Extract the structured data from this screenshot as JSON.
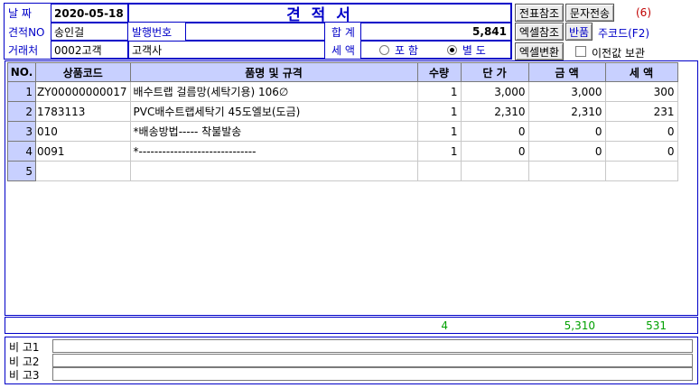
{
  "header": {
    "date_label": "날 짜",
    "date_value": "2020-05-18",
    "title": "견 적 서",
    "quote_no_label": "견적NO",
    "quote_no_value": "송인걸",
    "issue_no_label": "발행번호",
    "issue_no_value": "",
    "total_label": "합 계",
    "total_value": "5,841",
    "client_label": "거래처",
    "client_code": "0002고객",
    "client_name": "고객사",
    "tax_label": "세 액",
    "tax_option_included": "포 함",
    "tax_option_separate": "별 도",
    "tax_selected": "별 도"
  },
  "buttons": {
    "voucher_ref": "전표참조",
    "sms_send": "문자전송",
    "sms_count": "(6)",
    "excel_ref": "엑셀참조",
    "return_item": "반품",
    "main_code": "주코드(F2)",
    "excel_convert": "엑셀변환",
    "keep_previous": "이전값 보관"
  },
  "table": {
    "columns": [
      "NO.",
      "상품코드",
      "품명 및 규격",
      "수량",
      "단 가",
      "금 액",
      "세 액"
    ],
    "rows": [
      {
        "no": "1",
        "code": "ZY00000000017",
        "name": "배수트랩 걸름망(세탁기용) 106∅",
        "qty": "1",
        "price": "3,000",
        "amount": "3,000",
        "tax": "300"
      },
      {
        "no": "2",
        "code": "1783113",
        "name": "PVC배수트랩세탁기 45도엘보(도금)",
        "qty": "1",
        "price": "2,310",
        "amount": "2,310",
        "tax": "231"
      },
      {
        "no": "3",
        "code": "010",
        "name": "*배송방법----- 착불발송",
        "qty": "1",
        "price": "0",
        "amount": "0",
        "tax": "0"
      },
      {
        "no": "4",
        "code": "0091",
        "name": "*------------------------------",
        "qty": "1",
        "price": "0",
        "amount": "0",
        "tax": "0"
      },
      {
        "no": "5",
        "code": "",
        "name": "",
        "qty": "",
        "price": "",
        "amount": "",
        "tax": ""
      }
    ]
  },
  "summary": {
    "qty_total": "4",
    "amount_total": "5,310",
    "tax_total": "531"
  },
  "remarks": {
    "label1": "비 고1",
    "label2": "비 고2",
    "label3": "비 고3",
    "value1": "",
    "value2": "",
    "value3": ""
  },
  "colors": {
    "label_blue": "#0000c8",
    "header_bg": "#c8d0ff",
    "sum_green": "#00a000",
    "sms_count_red": "#c00000"
  }
}
